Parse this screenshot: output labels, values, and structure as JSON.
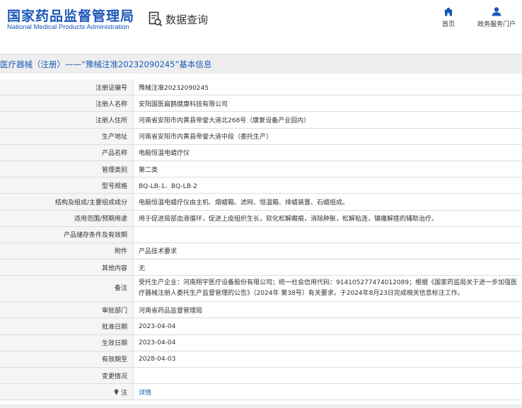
{
  "header": {
    "logo_cn": "国家药品监督管理局",
    "logo_en": "National Medical Products Administration",
    "search_label": "数据查询",
    "nav": [
      {
        "label": "首页",
        "icon": "home-icon"
      },
      {
        "label": "政务服务门户",
        "icon": "user-icon"
      }
    ]
  },
  "title": "医疗器械（注册）——“豫械注准20232090245”基本信息",
  "rows": [
    {
      "label": "注册证编号",
      "value": "豫械注准20232090245"
    },
    {
      "label": "注册人名称",
      "value": "安阳国医扁鹊健康科技有限公司"
    },
    {
      "label": "注册人住所",
      "value": "河南省安阳市内黄县帝誉大道北268号（康复设备产业园内）"
    },
    {
      "label": "生产地址",
      "value": "河南省安阳市内黄县帝誉大道中段（委托生产）"
    },
    {
      "label": "产品名称",
      "value": "电脑恒温电蜡疗仪"
    },
    {
      "label": "管理类别",
      "value": "第二类"
    },
    {
      "label": "型号规格",
      "value": "BQ-LB-1、BQ-LB-2"
    },
    {
      "label": "结构及组成/主要组成成分",
      "value": "电脑恒温电蜡疗仪由主机、熔蜡箱、滤网、恒温箱、排蜡装置、石蜡组成。"
    },
    {
      "label": "适用范围/预期用途",
      "value": "用于促进局部血液循环，促进上皮组织生长，软化松解瘢痕，消除肿胀，松解粘连，镇痛解痉的辅助治疗。"
    },
    {
      "label": "产品储存条件及有效期",
      "value": ""
    },
    {
      "label": "附件",
      "value": "产品技术要求"
    },
    {
      "label": "其他内容",
      "value": "无"
    },
    {
      "label": "备注",
      "value": "受托生产企业：河南翔宇医疗设备股份有限公司；统一社会信用代码：914105277474012089；根据《国家药监局关于进一步加强医疗器械注册人委托生产监督管理的公告》（2024年 第38号）有关要求，于2024年8月23日完成相关信息标注工作。"
    },
    {
      "label": "审批部门",
      "value": "河南省药品监督管理局"
    },
    {
      "label": "批准日期",
      "value": "2023-04-04"
    },
    {
      "label": "生效日期",
      "value": "2023-04-04"
    },
    {
      "label": "有效期至",
      "value": "2028-04-03"
    },
    {
      "label": "变更情况",
      "value": ""
    },
    {
      "label": "注",
      "value": "详情"
    }
  ],
  "colors": {
    "brand_blue": "#1a56b8",
    "title_bar_bg": "#eeeeee",
    "label_bg": "#f5f5f5",
    "border": "#dcdcdc"
  }
}
